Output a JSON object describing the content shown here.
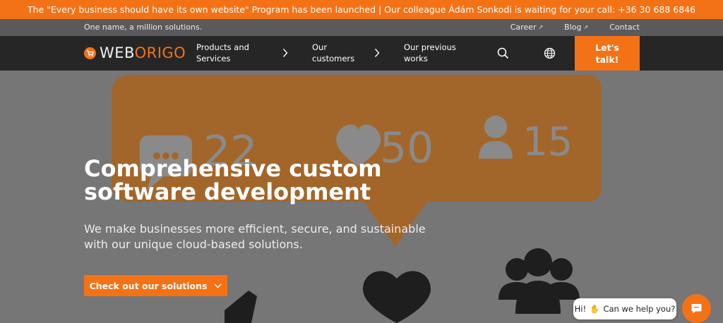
{
  "announcement": "The \"Every business should have its own website\" Program has been launched | Our colleague Ádám Sonkodi is waiting for your call: +36 30 688 6846",
  "topbar": {
    "tagline": "One name, a million solutions.",
    "links": [
      {
        "label": "Career",
        "icon": "external-link-icon"
      },
      {
        "label": "Blog",
        "icon": "external-link-icon"
      },
      {
        "label": "Contact"
      }
    ]
  },
  "nav": {
    "logo_text_a": "WEB",
    "logo_text_b": "ORIGO",
    "items": [
      {
        "line1": "Products and",
        "line2": "Services"
      },
      {
        "line1": "Our",
        "line2": "customers"
      },
      {
        "line1": "Our previous",
        "line2": "works"
      }
    ],
    "cta_line1": "Let's",
    "cta_line2": "talk!"
  },
  "hero": {
    "title_line1": "Comprehensive custom",
    "title_line2": "software development",
    "subtitle_line1": "We make businesses more efficient, secure, and sustainable",
    "subtitle_line2": "with our unique cloud-based solutions.",
    "button_label": "Check out our solutions",
    "art": {
      "comments_count": "22",
      "likes_count": "50",
      "followers_count": "15"
    }
  },
  "chat": {
    "greeting_a": "Hi!",
    "greeting_b": "Can we help you?"
  },
  "colors": {
    "accent": "#f47216",
    "nav_bg": "#262626",
    "topbar_bg": "#5a5a5a",
    "hero_bg": "#767676"
  }
}
